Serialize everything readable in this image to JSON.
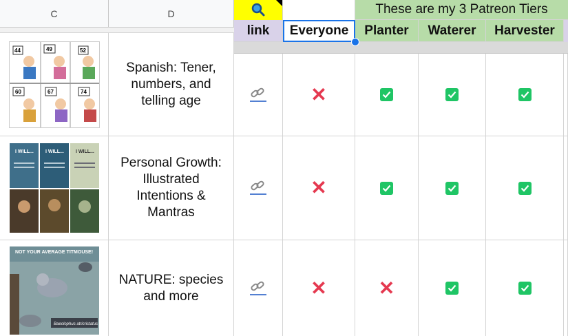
{
  "columns": {
    "c": "C",
    "d": "D"
  },
  "header": {
    "banner": "These are my 3 Patreon Tiers",
    "link": "link",
    "everyone": "Everyone",
    "planter": "Planter",
    "waterer": "Waterer",
    "harvester": "Harvester"
  },
  "rows": [
    {
      "title": "Spanish: Tener, numbers, and telling age",
      "everyone": "no",
      "planter": "yes",
      "waterer": "yes",
      "harvester": "yes",
      "thumb_numbers": [
        "44",
        "49",
        "52",
        "60",
        "67",
        "74"
      ]
    },
    {
      "title": "Personal Growth: Illustrated Intentions & Mantras",
      "everyone": "no",
      "planter": "yes",
      "waterer": "yes",
      "harvester": "yes",
      "thumb_text": [
        "I WILL...",
        "I WILL...",
        "I WILL..."
      ]
    },
    {
      "title": "NATURE: species and more",
      "everyone": "no",
      "planter": "no",
      "waterer": "yes",
      "harvester": "yes",
      "thumb_text": [
        "NOT YOUR AVERAGE TITMOUSE!",
        "Baeolophus atricristatus"
      ]
    }
  ],
  "symbols": {
    "no": "✕"
  },
  "colors": {
    "tier_header": "#b7dca8",
    "link_header": "#d9d2e9",
    "selection": "#1a73e8",
    "check": "#1fc565",
    "cross": "#e53950",
    "search_bg": "#ffff00"
  }
}
